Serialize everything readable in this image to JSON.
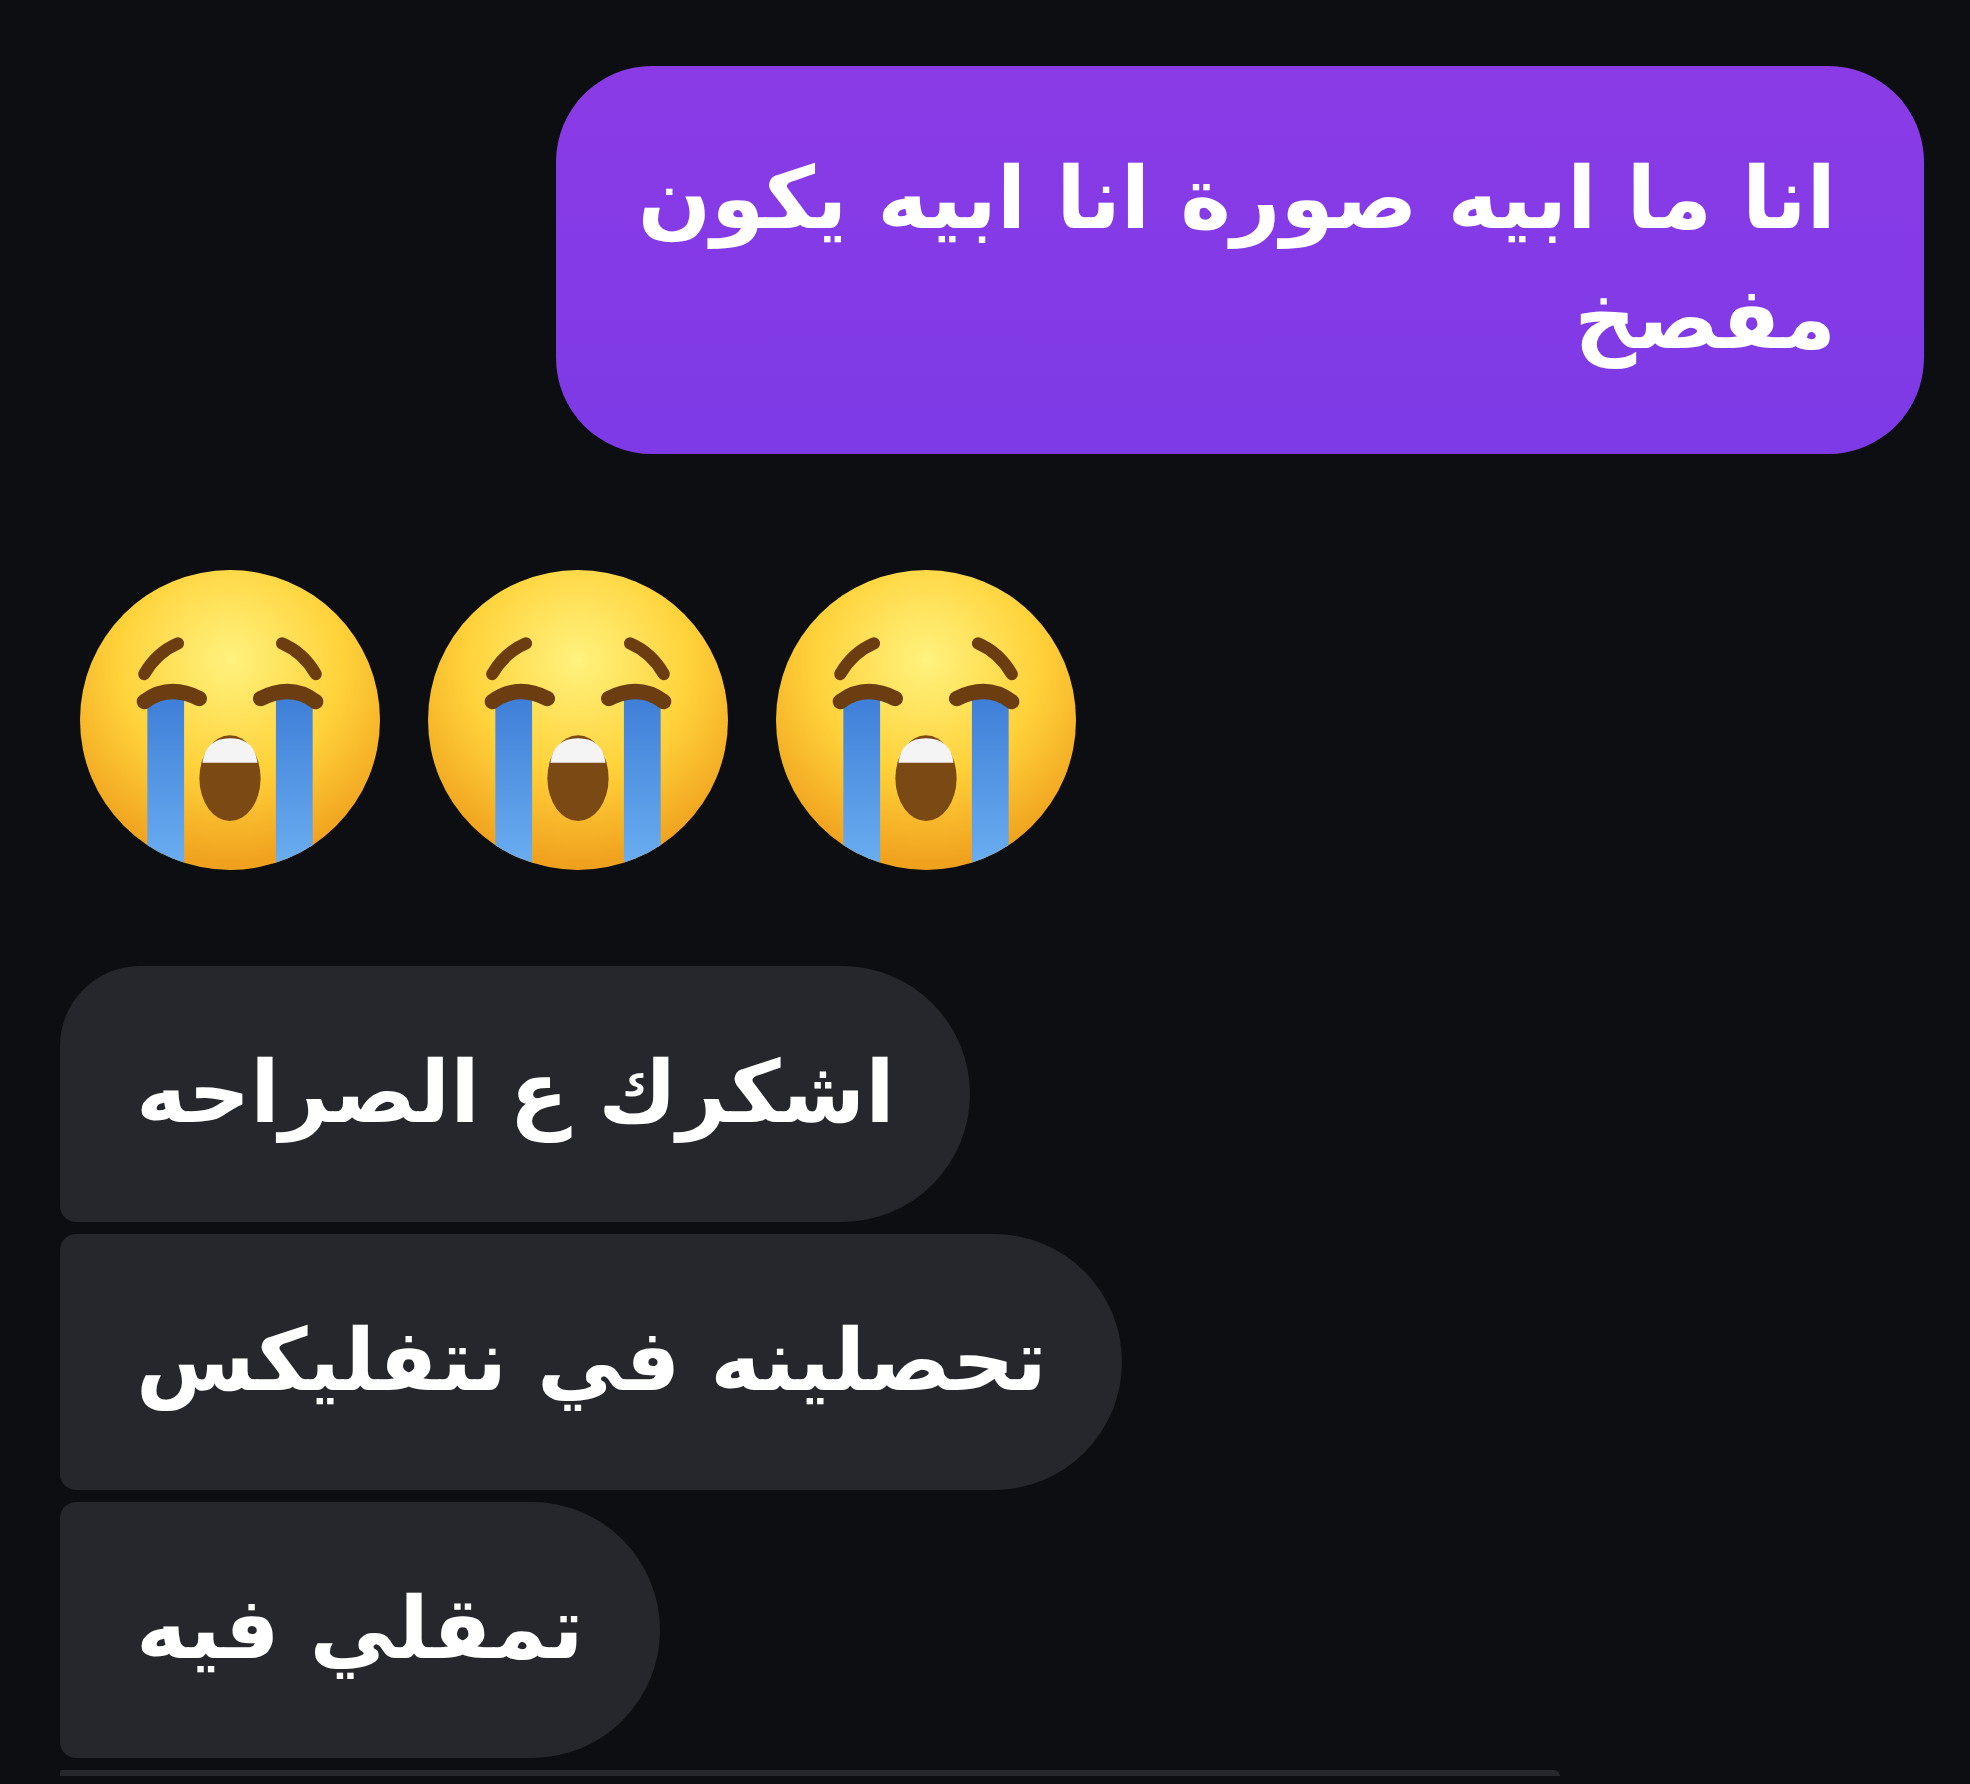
{
  "messages": [
    {
      "kind": "text",
      "outgoing": true,
      "text": "انا ما ابيه صورة انا ابيه يكون مفصخ"
    },
    {
      "kind": "emoji",
      "outgoing": false,
      "emojis": [
        {
          "kind": "loudly_crying"
        },
        {
          "kind": "loudly_crying"
        },
        {
          "kind": "loudly_crying"
        }
      ]
    },
    {
      "kind": "text",
      "outgoing": false,
      "text": "اشكرك ع الصراحه"
    },
    {
      "kind": "text",
      "outgoing": false,
      "text": "تحصلينه في نتفليكس"
    },
    {
      "kind": "text",
      "outgoing": false,
      "text": "تمقلي فيه"
    },
    {
      "kind": "cut_off",
      "outgoing": false
    }
  ]
}
